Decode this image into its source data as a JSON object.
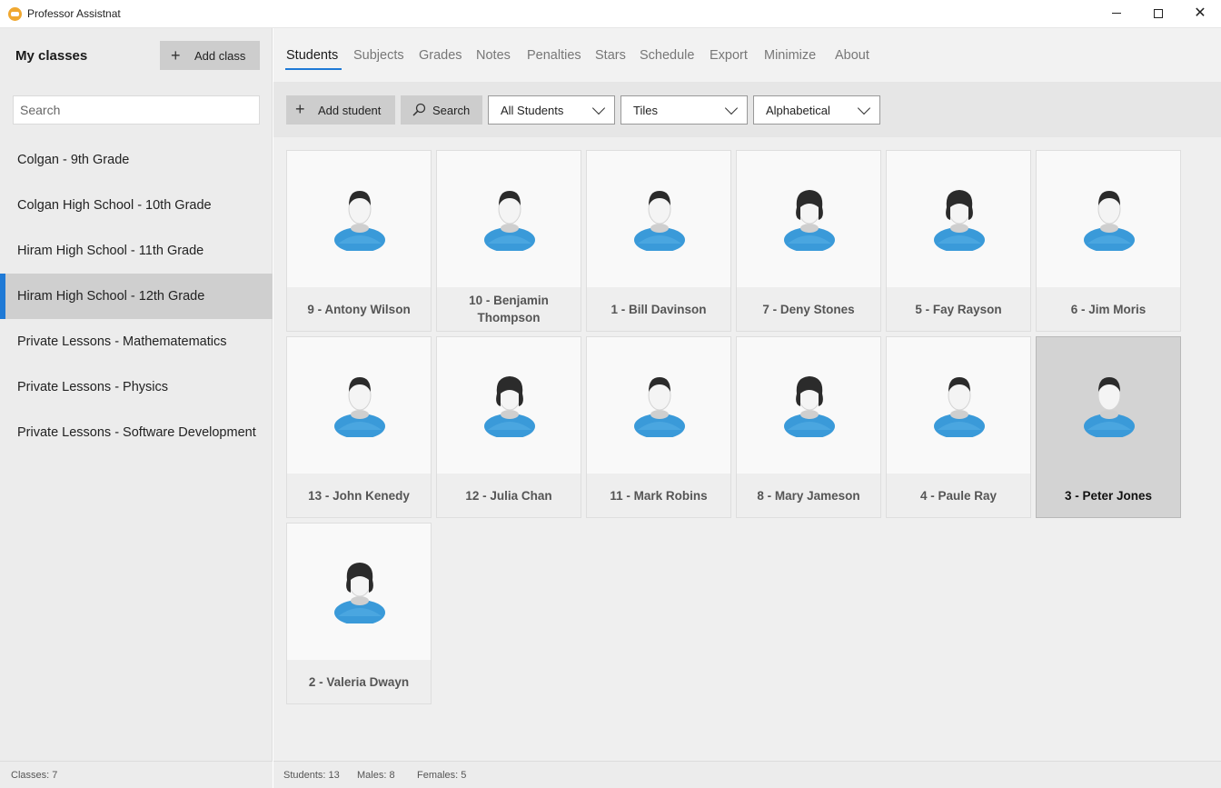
{
  "window": {
    "title": "Professor Assistnat"
  },
  "sidebar": {
    "heading": "My classes",
    "add_class_label": "Add class",
    "search_placeholder": "Search",
    "classes": [
      "Colgan - 9th Grade",
      "Colgan High School - 10th Grade",
      "Hiram High School - 11th Grade",
      "Hiram High School - 12th Grade",
      "Private Lessons - Mathematematics",
      "Private Lessons - Physics",
      "Private Lessons - Software Development"
    ],
    "selected_class_index": 3,
    "status": "Classes: 7"
  },
  "tabs": [
    "Students",
    "Subjects",
    "Grades",
    "Notes",
    "Penalties",
    "Stars",
    "Schedule",
    "Export",
    "Minimize",
    "About"
  ],
  "toolbar": {
    "add_student_label": "Add student",
    "search_label": "Search",
    "filter_value": "All Students",
    "view_value": "Tiles",
    "sort_value": "Alphabetical"
  },
  "students": [
    {
      "label": "9 - Antony Wilson",
      "gender": "male"
    },
    {
      "label": "10 - Benjamin Thompson",
      "gender": "male"
    },
    {
      "label": "1 - Bill Davinson",
      "gender": "male"
    },
    {
      "label": "7 - Deny Stones",
      "gender": "female"
    },
    {
      "label": "5 - Fay Rayson",
      "gender": "female"
    },
    {
      "label": "6 - Jim Moris",
      "gender": "male"
    },
    {
      "label": "13 - John Kenedy",
      "gender": "male"
    },
    {
      "label": "12 - Julia Chan",
      "gender": "female"
    },
    {
      "label": "11 - Mark Robins",
      "gender": "male"
    },
    {
      "label": "8 - Mary Jameson",
      "gender": "female"
    },
    {
      "label": "4 - Paule Ray",
      "gender": "male"
    },
    {
      "label": "3 - Peter Jones",
      "gender": "male",
      "selected": true
    },
    {
      "label": "2 - Valeria Dwayn",
      "gender": "female"
    }
  ],
  "status": {
    "students": "Students: 13",
    "males": "Males: 8",
    "females": "Females: 5"
  },
  "colors": {
    "accent": "#1f7ad6",
    "avatar_shirt": "#3a9ad9",
    "hair": "#2b2b2b"
  }
}
